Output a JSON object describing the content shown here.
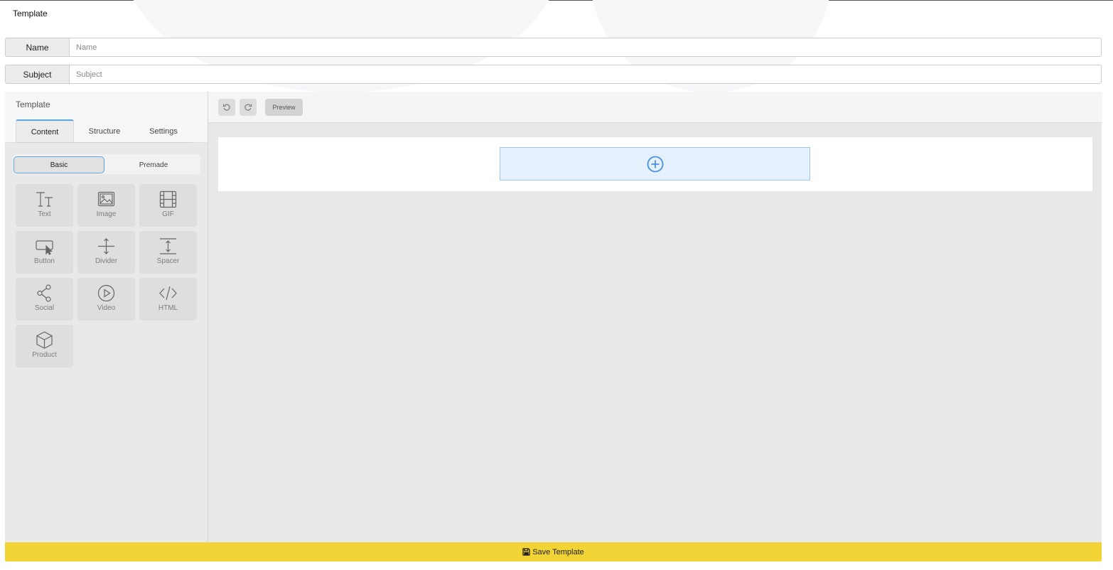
{
  "page": {
    "title": "Template"
  },
  "form": {
    "name": {
      "label": "Name",
      "placeholder": "Name",
      "value": ""
    },
    "subject": {
      "label": "Subject",
      "placeholder": "Subject",
      "value": ""
    }
  },
  "sidebar": {
    "title": "Template",
    "tabs": [
      {
        "label": "Content",
        "active": true
      },
      {
        "label": "Structure",
        "active": false
      },
      {
        "label": "Settings",
        "active": false
      }
    ],
    "subtabs": [
      {
        "label": "Basic",
        "active": true
      },
      {
        "label": "Premade",
        "active": false
      }
    ],
    "blocks": [
      {
        "label": "Text",
        "icon": "text-icon"
      },
      {
        "label": "Image",
        "icon": "image-icon"
      },
      {
        "label": "GIF",
        "icon": "film-icon"
      },
      {
        "label": "Button",
        "icon": "button-cursor-icon"
      },
      {
        "label": "Divider",
        "icon": "divider-icon"
      },
      {
        "label": "Spacer",
        "icon": "spacer-icon"
      },
      {
        "label": "Social",
        "icon": "share-icon"
      },
      {
        "label": "Video",
        "icon": "play-icon"
      },
      {
        "label": "HTML",
        "icon": "code-icon"
      },
      {
        "label": "Product",
        "icon": "cube-icon"
      }
    ]
  },
  "toolbar": {
    "undo_icon": "undo-icon",
    "redo_icon": "redo-icon",
    "preview_label": "Preview"
  },
  "canvas": {
    "add_icon": "plus-circle-icon"
  },
  "footer": {
    "save_label": "Save Template",
    "save_icon": "floppy-disk-icon"
  },
  "colors": {
    "accent": "#5aa7e8",
    "save_bar": "#f3d437",
    "drop_zone": "#e4f0fb"
  }
}
